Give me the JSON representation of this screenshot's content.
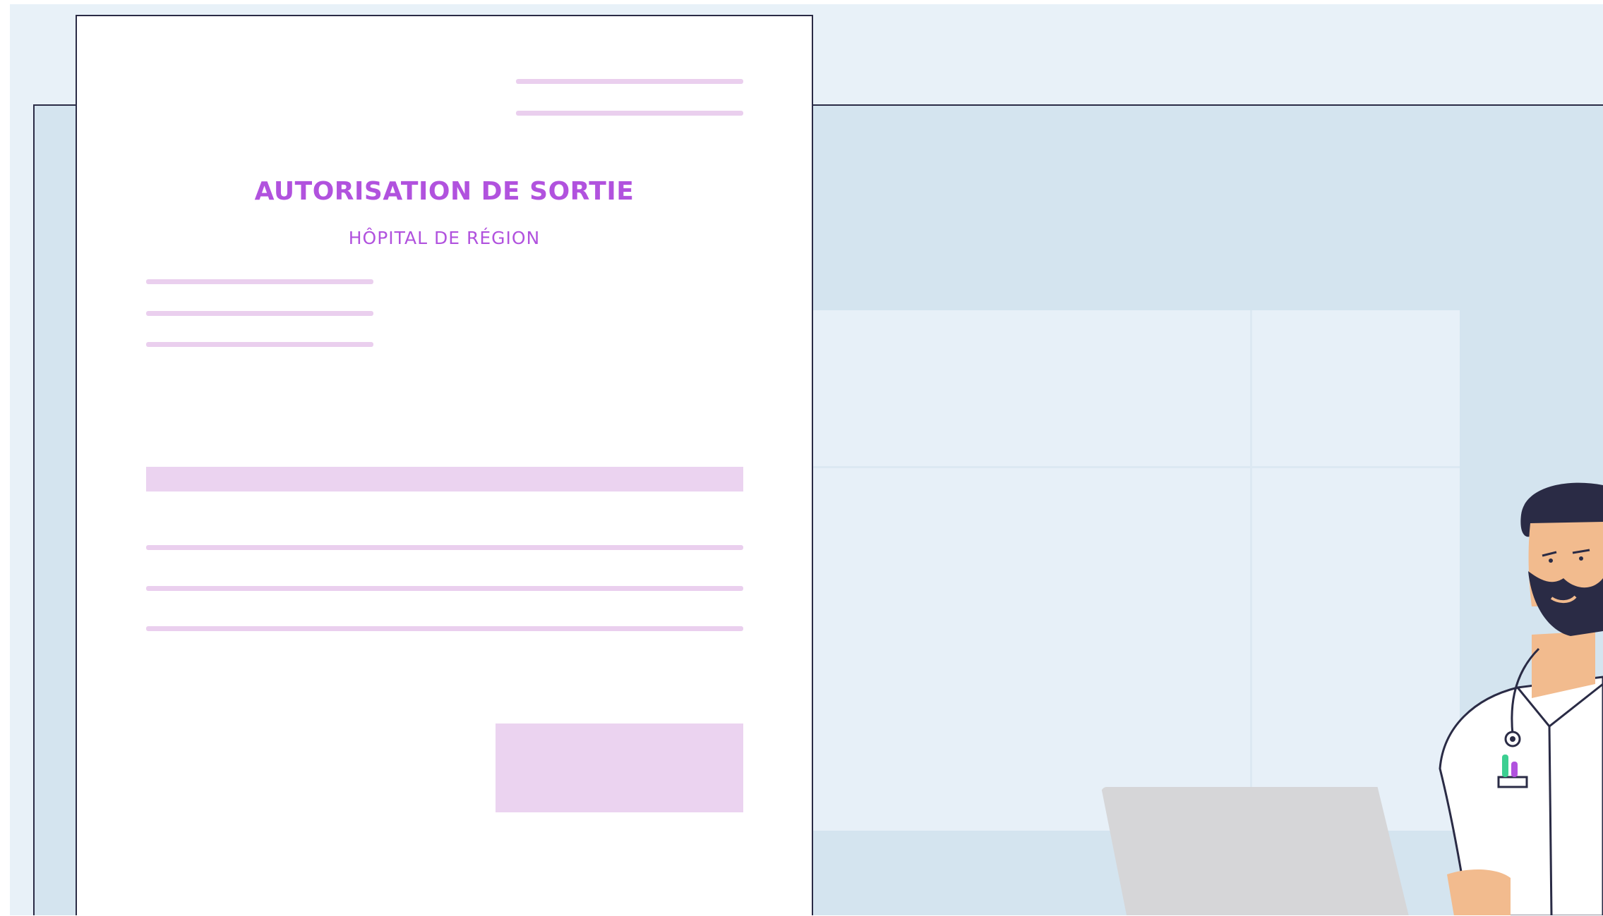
{
  "document": {
    "title": "AUTORISATION DE SORTIE",
    "subtitle": "HÔPITAL DE RÉGION"
  },
  "colors": {
    "accent": "#b152de",
    "placeholder_line": "#eacfee",
    "wall": "#d4e4ef",
    "outline": "#2a2b45"
  },
  "illustration": {
    "character": "doctor",
    "device": "laptop"
  }
}
